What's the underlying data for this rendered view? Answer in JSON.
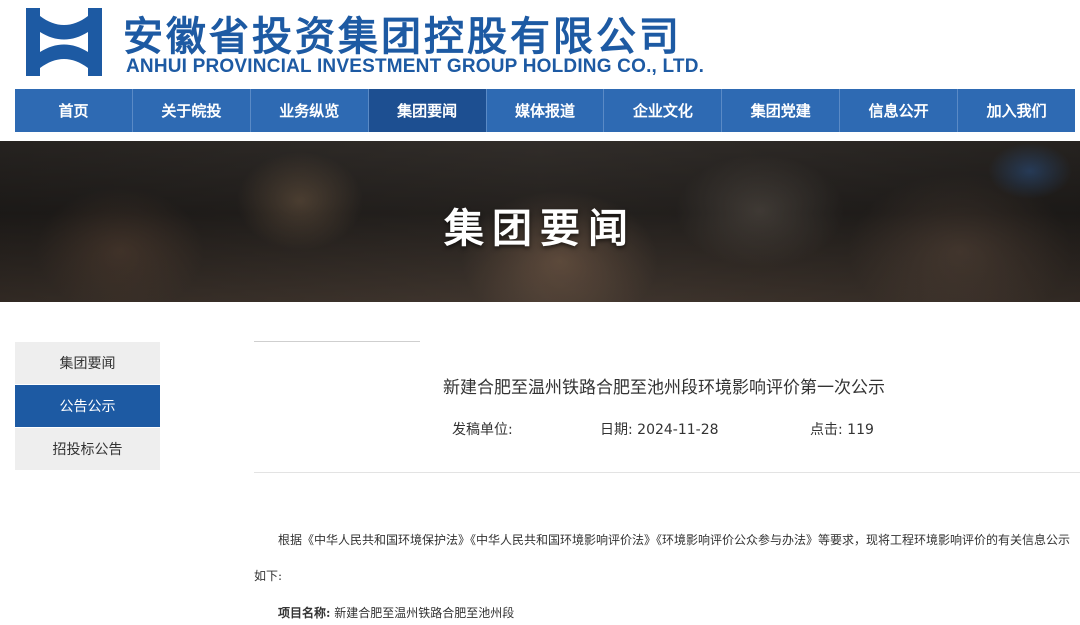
{
  "brand": {
    "name_cn": "安徽省投资集团控股有限公司",
    "name_en": "ANHUI PROVINCIAL INVESTMENT GROUP HOLDING CO., LTD.",
    "logo_icon": "anhui-investment-logo",
    "color": "#1d5aa3"
  },
  "nav": {
    "items": [
      {
        "label": "首页"
      },
      {
        "label": "关于皖投"
      },
      {
        "label": "业务纵览"
      },
      {
        "label": "集团要闻",
        "active": true
      },
      {
        "label": "媒体报道"
      },
      {
        "label": "企业文化"
      },
      {
        "label": "集团党建"
      },
      {
        "label": "信息公开"
      },
      {
        "label": "加入我们"
      }
    ],
    "bg_color": "#2e6ab3",
    "active_color": "#1d4f91"
  },
  "banner": {
    "title": "集团要闻"
  },
  "sidebar": {
    "items": [
      {
        "label": "集团要闻"
      },
      {
        "label": "公告公示",
        "active": true
      },
      {
        "label": "招投标公告"
      }
    ]
  },
  "article": {
    "title": "新建合肥至温州铁路合肥至池州段环境影响评价第一次公示",
    "meta": {
      "source_label": "发稿单位:",
      "date_label": "日期:",
      "date": "2024-11-28",
      "clicks_label": "点击:",
      "clicks": "119"
    },
    "paragraph": "根据《中华人民共和国环境保护法》《中华人民共和国环境影响评价法》《环境影响评价公众参与办法》等要求，现将工程环境影响评价的有关信息公示如下:",
    "project_label": "项目名称:",
    "project_value": "新建合肥至温州铁路合肥至池州段"
  }
}
